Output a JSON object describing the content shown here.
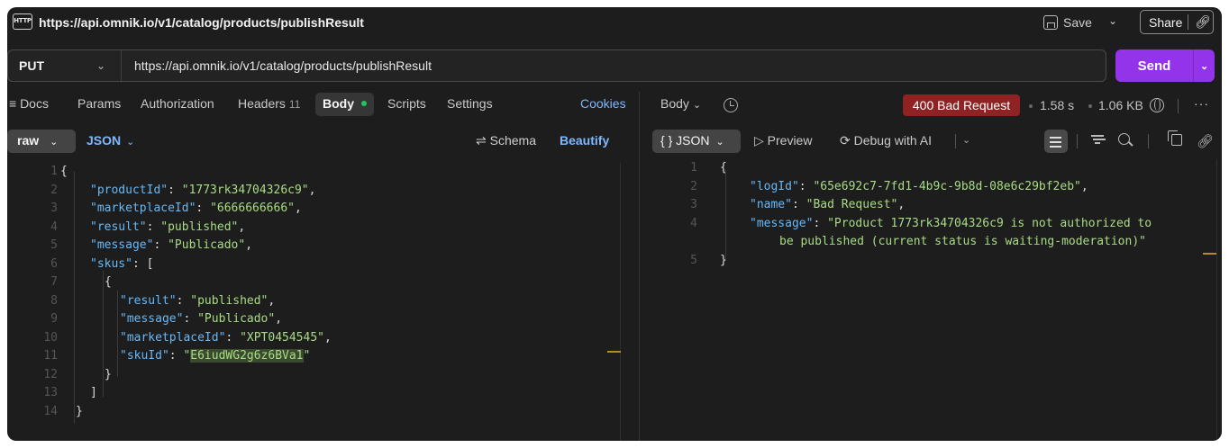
{
  "title": "https://api.omnik.io/v1/catalog/products/publishResult",
  "title_icon": "HTTP",
  "header": {
    "save_label": "Save",
    "share_label": "Share"
  },
  "request": {
    "method": "PUT",
    "url": "https://api.omnik.io/v1/catalog/products/publishResult",
    "send_label": "Send"
  },
  "tabs": {
    "docs": "Docs",
    "params": "Params",
    "authorization": "Authorization",
    "headers": "Headers",
    "headers_count": "11",
    "body": "Body",
    "scripts": "Scripts",
    "settings": "Settings",
    "cookies": "Cookies"
  },
  "body_toolbar": {
    "mode": "raw",
    "format": "JSON",
    "schema": "Schema",
    "beautify": "Beautify"
  },
  "request_body": {
    "line_numbers": [
      "1",
      "2",
      "3",
      "4",
      "5",
      "6",
      "7",
      "8",
      "9",
      "10",
      "11",
      "12",
      "13",
      "14"
    ],
    "lines": [
      [
        {
          "t": "p",
          "v": "{"
        }
      ],
      [
        {
          "t": "k",
          "v": "\"productId\""
        },
        {
          "t": "p",
          "v": ": "
        },
        {
          "t": "s",
          "v": "\"1773rk34704326c9\""
        },
        {
          "t": "p",
          "v": ","
        }
      ],
      [
        {
          "t": "k",
          "v": "\"marketplaceId\""
        },
        {
          "t": "p",
          "v": ": "
        },
        {
          "t": "s",
          "v": "\"6666666666\""
        },
        {
          "t": "p",
          "v": ","
        }
      ],
      [
        {
          "t": "k",
          "v": "\"result\""
        },
        {
          "t": "p",
          "v": ": "
        },
        {
          "t": "s",
          "v": "\"published\""
        },
        {
          "t": "p",
          "v": ","
        }
      ],
      [
        {
          "t": "k",
          "v": "\"message\""
        },
        {
          "t": "p",
          "v": ": "
        },
        {
          "t": "s",
          "v": "\"Publicado\""
        },
        {
          "t": "p",
          "v": ","
        }
      ],
      [
        {
          "t": "k",
          "v": "\"skus\""
        },
        {
          "t": "p",
          "v": ": ["
        }
      ],
      [
        {
          "t": "p",
          "v": "{"
        }
      ],
      [
        {
          "t": "k",
          "v": "\"result\""
        },
        {
          "t": "p",
          "v": ": "
        },
        {
          "t": "s",
          "v": "\"published\""
        },
        {
          "t": "p",
          "v": ","
        }
      ],
      [
        {
          "t": "k",
          "v": "\"message\""
        },
        {
          "t": "p",
          "v": ": "
        },
        {
          "t": "s",
          "v": "\"Publicado\""
        },
        {
          "t": "p",
          "v": ","
        }
      ],
      [
        {
          "t": "k",
          "v": "\"marketplaceId\""
        },
        {
          "t": "p",
          "v": ": "
        },
        {
          "t": "s",
          "v": "\"XPT0454545\""
        },
        {
          "t": "p",
          "v": ","
        }
      ],
      [
        {
          "t": "k",
          "v": "\"skuId\""
        },
        {
          "t": "p",
          "v": ": "
        },
        {
          "t": "s",
          "v": "\""
        },
        {
          "t": "s hl",
          "v": "E6iudWG2g6z6BVa1"
        },
        {
          "t": "s",
          "v": "\""
        }
      ],
      [
        {
          "t": "p",
          "v": "}"
        }
      ],
      [
        {
          "t": "p",
          "v": "]"
        }
      ],
      [
        {
          "t": "p",
          "v": "}"
        }
      ]
    ]
  },
  "response": {
    "body_label": "Body",
    "status": "400 Bad Request",
    "time": "1.58 s",
    "size": "1.06 KB",
    "view_format": "JSON",
    "preview_label": "Preview",
    "debug_label": "Debug with AI",
    "line_numbers": [
      "1",
      "2",
      "3",
      "4",
      "",
      "5"
    ],
    "lines": [
      [
        {
          "t": "p",
          "v": "{"
        }
      ],
      [
        {
          "t": "k",
          "v": "\"logId\""
        },
        {
          "t": "p",
          "v": ": "
        },
        {
          "t": "s",
          "v": "\"65e692c7-7fd1-4b9c-9b8d-08e6c29bf2eb\""
        },
        {
          "t": "p",
          "v": ","
        }
      ],
      [
        {
          "t": "k",
          "v": "\"name\""
        },
        {
          "t": "p",
          "v": ": "
        },
        {
          "t": "s",
          "v": "\"Bad Request\""
        },
        {
          "t": "p",
          "v": ","
        }
      ],
      [
        {
          "t": "k",
          "v": "\"message\""
        },
        {
          "t": "p",
          "v": ": "
        },
        {
          "t": "s",
          "v": "\"Product 1773rk34704326c9 is not authorized to"
        }
      ],
      [
        {
          "t": "s",
          "v": "be published (current status is waiting-moderation)\""
        }
      ],
      [
        {
          "t": "p",
          "v": "}"
        }
      ]
    ]
  },
  "colors": {
    "background": "#1d1d1d",
    "send": "#9333ea",
    "error_badge": "#8f2323",
    "accent_link": "#7db7ff",
    "json_key": "#67b8f7",
    "json_string": "#a8dc84",
    "body_dot": "#22c55e"
  },
  "icons": [
    "http-icon",
    "save-icon",
    "chevron-down-icon",
    "link-icon",
    "menu-lines-icon",
    "history-icon",
    "globe-icon",
    "more-icon",
    "play-icon",
    "debug-ai-icon",
    "wrap-icon",
    "filter-icon",
    "search-icon",
    "copy-icon",
    "schema-icon"
  ]
}
